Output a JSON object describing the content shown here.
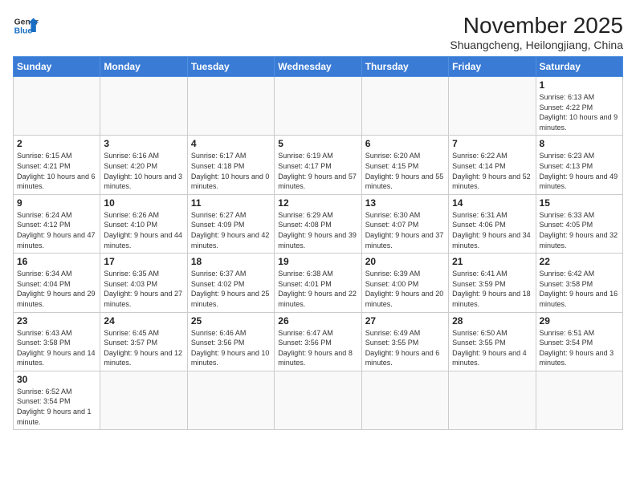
{
  "header": {
    "logo_general": "General",
    "logo_blue": "Blue",
    "month_year": "November 2025",
    "location": "Shuangcheng, Heilongjiang, China"
  },
  "weekdays": [
    "Sunday",
    "Monday",
    "Tuesday",
    "Wednesday",
    "Thursday",
    "Friday",
    "Saturday"
  ],
  "weeks": [
    [
      {
        "day": "",
        "info": ""
      },
      {
        "day": "",
        "info": ""
      },
      {
        "day": "",
        "info": ""
      },
      {
        "day": "",
        "info": ""
      },
      {
        "day": "",
        "info": ""
      },
      {
        "day": "",
        "info": ""
      },
      {
        "day": "1",
        "info": "Sunrise: 6:13 AM\nSunset: 4:22 PM\nDaylight: 10 hours\nand 9 minutes."
      }
    ],
    [
      {
        "day": "2",
        "info": "Sunrise: 6:15 AM\nSunset: 4:21 PM\nDaylight: 10 hours\nand 6 minutes."
      },
      {
        "day": "3",
        "info": "Sunrise: 6:16 AM\nSunset: 4:20 PM\nDaylight: 10 hours\nand 3 minutes."
      },
      {
        "day": "4",
        "info": "Sunrise: 6:17 AM\nSunset: 4:18 PM\nDaylight: 10 hours\nand 0 minutes."
      },
      {
        "day": "5",
        "info": "Sunrise: 6:19 AM\nSunset: 4:17 PM\nDaylight: 9 hours\nand 57 minutes."
      },
      {
        "day": "6",
        "info": "Sunrise: 6:20 AM\nSunset: 4:15 PM\nDaylight: 9 hours\nand 55 minutes."
      },
      {
        "day": "7",
        "info": "Sunrise: 6:22 AM\nSunset: 4:14 PM\nDaylight: 9 hours\nand 52 minutes."
      },
      {
        "day": "8",
        "info": "Sunrise: 6:23 AM\nSunset: 4:13 PM\nDaylight: 9 hours\nand 49 minutes."
      }
    ],
    [
      {
        "day": "9",
        "info": "Sunrise: 6:24 AM\nSunset: 4:12 PM\nDaylight: 9 hours\nand 47 minutes."
      },
      {
        "day": "10",
        "info": "Sunrise: 6:26 AM\nSunset: 4:10 PM\nDaylight: 9 hours\nand 44 minutes."
      },
      {
        "day": "11",
        "info": "Sunrise: 6:27 AM\nSunset: 4:09 PM\nDaylight: 9 hours\nand 42 minutes."
      },
      {
        "day": "12",
        "info": "Sunrise: 6:29 AM\nSunset: 4:08 PM\nDaylight: 9 hours\nand 39 minutes."
      },
      {
        "day": "13",
        "info": "Sunrise: 6:30 AM\nSunset: 4:07 PM\nDaylight: 9 hours\nand 37 minutes."
      },
      {
        "day": "14",
        "info": "Sunrise: 6:31 AM\nSunset: 4:06 PM\nDaylight: 9 hours\nand 34 minutes."
      },
      {
        "day": "15",
        "info": "Sunrise: 6:33 AM\nSunset: 4:05 PM\nDaylight: 9 hours\nand 32 minutes."
      }
    ],
    [
      {
        "day": "16",
        "info": "Sunrise: 6:34 AM\nSunset: 4:04 PM\nDaylight: 9 hours\nand 29 minutes."
      },
      {
        "day": "17",
        "info": "Sunrise: 6:35 AM\nSunset: 4:03 PM\nDaylight: 9 hours\nand 27 minutes."
      },
      {
        "day": "18",
        "info": "Sunrise: 6:37 AM\nSunset: 4:02 PM\nDaylight: 9 hours\nand 25 minutes."
      },
      {
        "day": "19",
        "info": "Sunrise: 6:38 AM\nSunset: 4:01 PM\nDaylight: 9 hours\nand 22 minutes."
      },
      {
        "day": "20",
        "info": "Sunrise: 6:39 AM\nSunset: 4:00 PM\nDaylight: 9 hours\nand 20 minutes."
      },
      {
        "day": "21",
        "info": "Sunrise: 6:41 AM\nSunset: 3:59 PM\nDaylight: 9 hours\nand 18 minutes."
      },
      {
        "day": "22",
        "info": "Sunrise: 6:42 AM\nSunset: 3:58 PM\nDaylight: 9 hours\nand 16 minutes."
      }
    ],
    [
      {
        "day": "23",
        "info": "Sunrise: 6:43 AM\nSunset: 3:58 PM\nDaylight: 9 hours\nand 14 minutes."
      },
      {
        "day": "24",
        "info": "Sunrise: 6:45 AM\nSunset: 3:57 PM\nDaylight: 9 hours\nand 12 minutes."
      },
      {
        "day": "25",
        "info": "Sunrise: 6:46 AM\nSunset: 3:56 PM\nDaylight: 9 hours\nand 10 minutes."
      },
      {
        "day": "26",
        "info": "Sunrise: 6:47 AM\nSunset: 3:56 PM\nDaylight: 9 hours\nand 8 minutes."
      },
      {
        "day": "27",
        "info": "Sunrise: 6:49 AM\nSunset: 3:55 PM\nDaylight: 9 hours\nand 6 minutes."
      },
      {
        "day": "28",
        "info": "Sunrise: 6:50 AM\nSunset: 3:55 PM\nDaylight: 9 hours\nand 4 minutes."
      },
      {
        "day": "29",
        "info": "Sunrise: 6:51 AM\nSunset: 3:54 PM\nDaylight: 9 hours\nand 3 minutes."
      }
    ],
    [
      {
        "day": "30",
        "info": "Sunrise: 6:52 AM\nSunset: 3:54 PM\nDaylight: 9 hours\nand 1 minute."
      },
      {
        "day": "",
        "info": ""
      },
      {
        "day": "",
        "info": ""
      },
      {
        "day": "",
        "info": ""
      },
      {
        "day": "",
        "info": ""
      },
      {
        "day": "",
        "info": ""
      },
      {
        "day": "",
        "info": ""
      }
    ]
  ]
}
